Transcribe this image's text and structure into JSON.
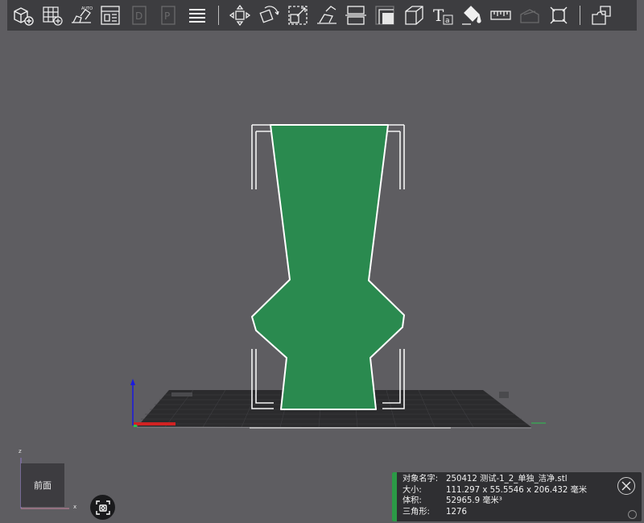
{
  "toolbar": {
    "tools": [
      {
        "name": "add-object-icon",
        "disabled": false
      },
      {
        "name": "add-grid-object-icon",
        "disabled": false
      },
      {
        "name": "auto-arrange-icon",
        "disabled": false
      },
      {
        "name": "layout-icon",
        "disabled": false
      },
      {
        "name": "copy-icon",
        "disabled": true
      },
      {
        "name": "paste-icon",
        "disabled": true
      },
      {
        "name": "menu-icon",
        "disabled": false
      }
    ],
    "tools2": [
      {
        "name": "move-icon"
      },
      {
        "name": "rotate-icon"
      },
      {
        "name": "scale-icon"
      },
      {
        "name": "lay-flat-icon"
      },
      {
        "name": "split-icon"
      },
      {
        "name": "cut-icon"
      },
      {
        "name": "support-icon"
      },
      {
        "name": "hollow-icon"
      },
      {
        "name": "text-icon"
      },
      {
        "name": "paint-icon"
      },
      {
        "name": "measure-icon"
      },
      {
        "name": "seam-icon"
      },
      {
        "name": "fit-icon"
      },
      {
        "name": "assembly-icon"
      }
    ]
  },
  "view_cube": {
    "face_label": "前面",
    "axis_z": "z",
    "axis_x": "x"
  },
  "info": {
    "name_label": "对象名字:",
    "name_value": "250412 测试-1_2_单独_洁净.stl",
    "size_label": "大小:",
    "size_value": "111.297 x 55.5546 x 206.432 毫米",
    "volume_label": "体积:",
    "volume_value": "52965.9 毫米³",
    "triangles_label": "三角形:",
    "triangles_value": "1276"
  },
  "colors": {
    "model": "#2a8a4f",
    "accent": "#2b9a46",
    "background": "#5e5d61",
    "toolbar": "#3d3d40"
  }
}
